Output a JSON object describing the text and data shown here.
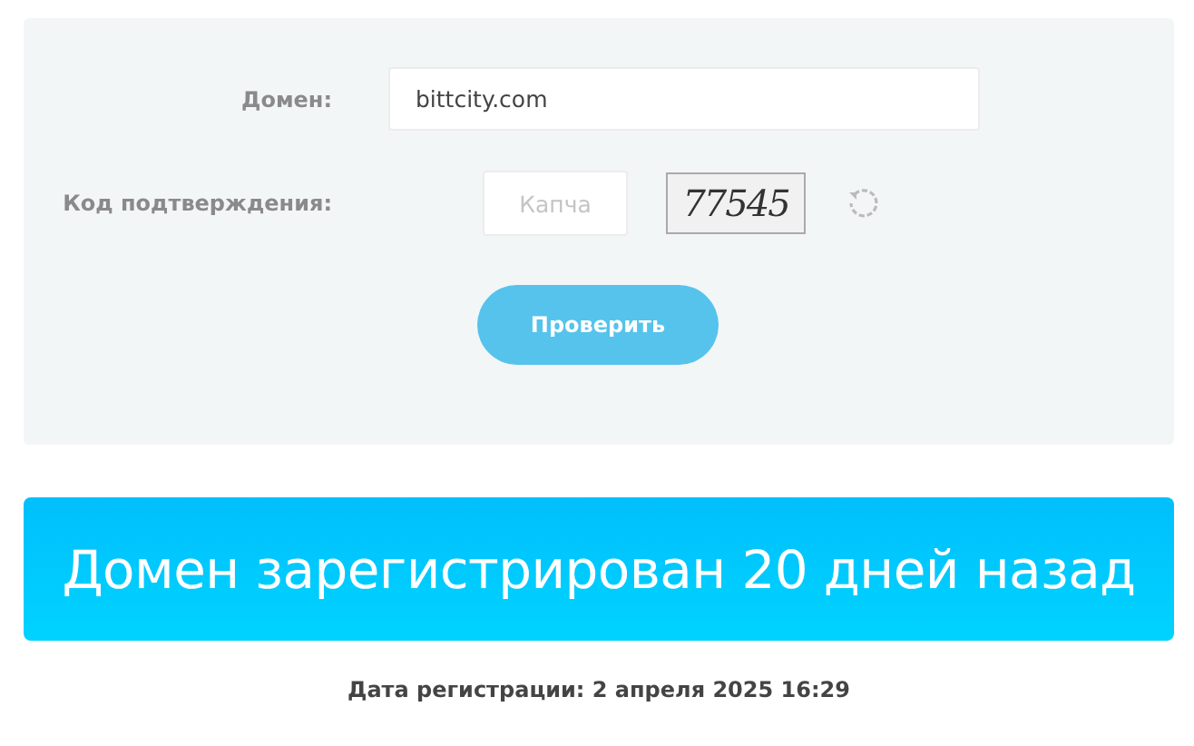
{
  "form": {
    "domain": {
      "label": "Домен:",
      "value": "bittcity.com"
    },
    "captcha": {
      "label": "Код подтверждения:",
      "placeholder": "Капча",
      "code": "77545"
    },
    "submit": "Проверить"
  },
  "result": {
    "banner": "Домен зарегистрирован 20 дней назад",
    "date": "Дата регистрации: 2 апреля 2025 16:29"
  }
}
